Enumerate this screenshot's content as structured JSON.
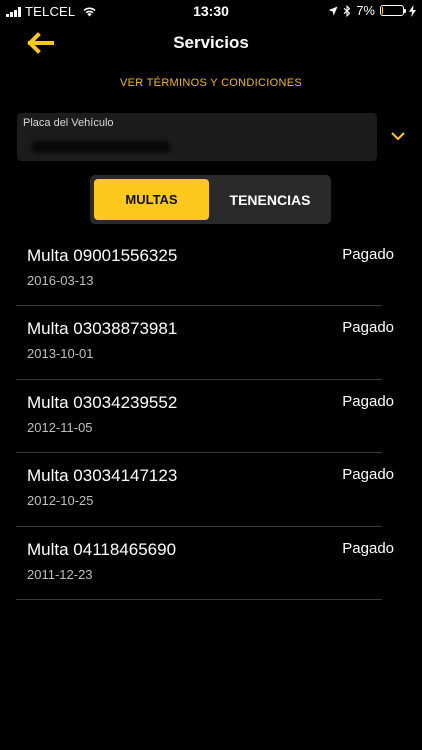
{
  "status_bar": {
    "carrier": "TELCEL",
    "time": "13:30",
    "battery": "7%",
    "battery_level": 0.07,
    "accent_color": "#ffc81e"
  },
  "nav": {
    "title": "Servicios",
    "back_icon": "arrow-left-icon"
  },
  "terms_link": "VER TÉRMINOS Y CONDICIONES",
  "plate_field": {
    "label": "Placa del Vehículo",
    "dropdown_icon": "chevron-down-icon"
  },
  "tabs": {
    "multas": "MULTAS",
    "tenencias": "TENENCIAS",
    "selected": "MULTAS"
  },
  "items": [
    {
      "title": "Multa 09001556325",
      "date": "2016-03-13",
      "status": "Pagado"
    },
    {
      "title": "Multa 03038873981",
      "date": "2013-10-01",
      "status": "Pagado"
    },
    {
      "title": "Multa 03034239552",
      "date": "2012-11-05",
      "status": "Pagado"
    },
    {
      "title": "Multa 03034147123",
      "date": "2012-10-25",
      "status": "Pagado"
    },
    {
      "title": "Multa 04118465690",
      "date": "2011-12-23",
      "status": "Pagado"
    }
  ]
}
